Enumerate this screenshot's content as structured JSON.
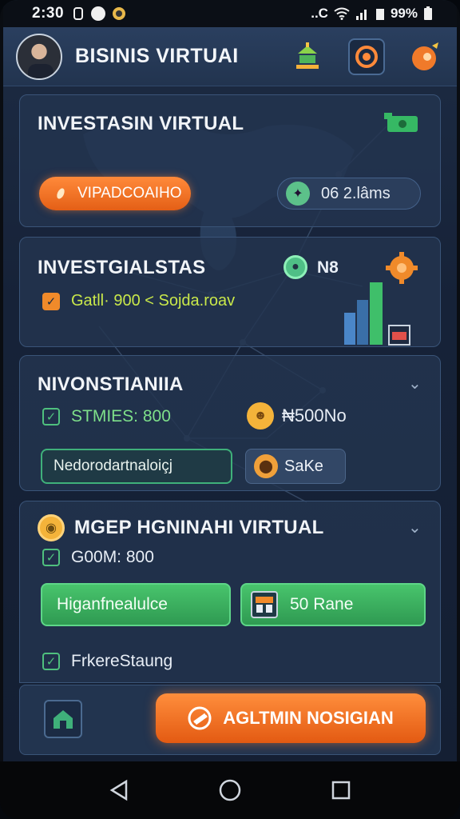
{
  "status_bar": {
    "time": "2:30",
    "battery": "99%",
    "carrier_mark": "..C"
  },
  "header": {
    "title": "BISINIS VIRTUAI",
    "icons": [
      "avatar",
      "bank-icon",
      "target-icon",
      "money-bag-icon"
    ]
  },
  "card1": {
    "title": "INVESTASIN VIRTUAL",
    "orange_pill": "VIPADCOAIHO",
    "stat_pill": "06 2.lâms"
  },
  "card2": {
    "title": "INVESTGIALSTAS",
    "badge_text": "N8",
    "row_text": "Gatll· 900 < Sojda.roav"
  },
  "card3": {
    "title": "NIVONSTIANIIA",
    "row_left": "STMIES: 800",
    "row_right": "₦500No",
    "btn_left": "Nedorodartnaloiçj",
    "btn_right": "SaKe"
  },
  "card4": {
    "title": "MGEP HGNINAHI VIRTUAL",
    "row": "G00M: 800",
    "btn_left": "Higanfnealulce",
    "btn_right": "50 Rane",
    "check_row": "FrkereStaung"
  },
  "bottom": {
    "cta": "AGLTMIN NOSIGIAN"
  },
  "colors": {
    "accent_orange": "#f07a2a",
    "accent_green": "#3fb07a",
    "bg": "#162238"
  }
}
